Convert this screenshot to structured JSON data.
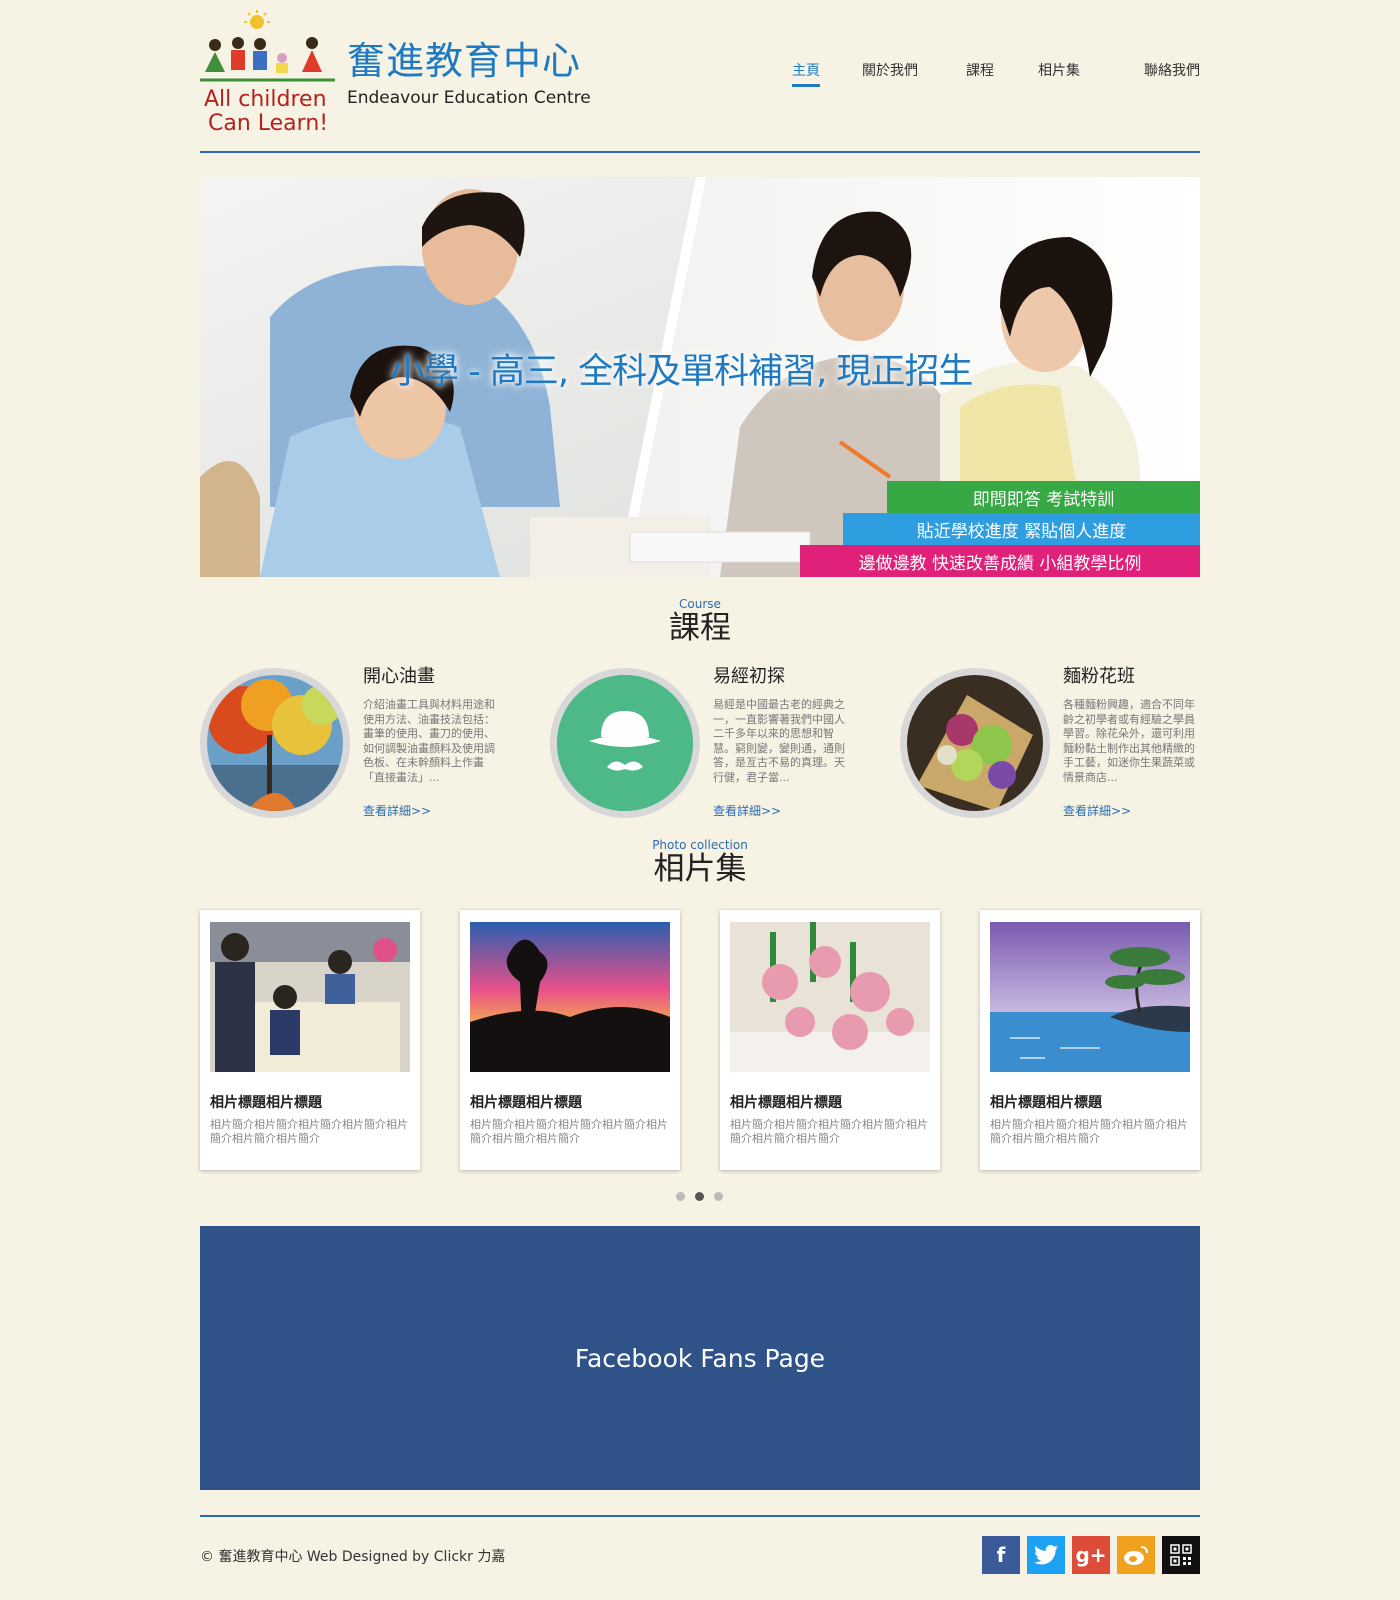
{
  "header": {
    "logo_text_line1": "All children",
    "logo_text_line2": "Can Learn!",
    "brand_cn": "奮進教育中心",
    "brand_en": "Endeavour Education Centre"
  },
  "nav": {
    "items": [
      {
        "label": "主頁",
        "active": true
      },
      {
        "label": "關於我們"
      },
      {
        "label": "課程"
      },
      {
        "label": "相片集"
      },
      {
        "label": "聯絡我們"
      }
    ]
  },
  "hero": {
    "headline": "小學 - 高三, 全科及單科補習, 現正招生",
    "band_green": "即問即答 考試特訓",
    "band_blue": "貼近學校進度 緊貼個人進度",
    "band_pink": "邊做邊教 快速改善成績 小組教學比例"
  },
  "courses_section": {
    "title_en": "Course",
    "title_cn": "課程",
    "items": [
      {
        "title": "開心油畫",
        "desc": "介紹油畫工具與材料用途和使用方法、油畫技法包括：畫筆的使用、畫刀的使用、如何調製油畫顏料及使用調色板、在未幹顏料上作畫「直接畫法」...",
        "link": "查看詳細>>"
      },
      {
        "title": "易經初探",
        "desc": "易經是中國最古老的經典之一，一直影響著我們中國人二千多年以來的思想和智慧。窮則變，變則通，通則答，是亙古不易的真理。天行健，君子當...",
        "link": "查看詳細>>"
      },
      {
        "title": "麵粉花班",
        "desc": "各種麵粉興趣，適合不同年齡之初學者或有經驗之學員學習。除花朵外，還可利用麵粉黏土制作出其他精緻的手工藝，如迷你生果蔬菜或情景商店...",
        "link": "查看詳細>>"
      }
    ]
  },
  "photos_section": {
    "title_en": "Photo collection",
    "title_cn": "相片集",
    "items": [
      {
        "title": "相片標題相片標題",
        "desc": "相片簡介相片簡介相片簡介相片簡介相片簡介相片簡介相片簡介"
      },
      {
        "title": "相片標題相片標題",
        "desc": "相片簡介相片簡介相片簡介相片簡介相片簡介相片簡介相片簡介"
      },
      {
        "title": "相片標題相片標題",
        "desc": "相片簡介相片簡介相片簡介相片簡介相片簡介相片簡介相片簡介"
      },
      {
        "title": "相片標題相片標題",
        "desc": "相片簡介相片簡介相片簡介相片簡介相片簡介相片簡介相片簡介"
      }
    ],
    "carousel_active_index": 1
  },
  "facebook": {
    "label": "Facebook Fans Page"
  },
  "footer": {
    "copyright": "© 奮進教育中心 Web Designed by Clickr 力嘉",
    "social": [
      {
        "icon": "facebook-icon",
        "glyph": "f",
        "color": "#3b5a9a"
      },
      {
        "icon": "twitter-icon",
        "glyph": "t",
        "color": "#1da1f2"
      },
      {
        "icon": "google-plus-icon",
        "glyph": "g+",
        "color": "#dd4b39"
      },
      {
        "icon": "weibo-icon",
        "glyph": "微",
        "color": "#f0a11e"
      },
      {
        "icon": "qr-code-icon",
        "glyph": "",
        "color": "#111111"
      }
    ]
  },
  "colors": {
    "accent": "#1f7ac2",
    "background": "#f6f2e4",
    "facebook_blue": "#2f5289"
  }
}
